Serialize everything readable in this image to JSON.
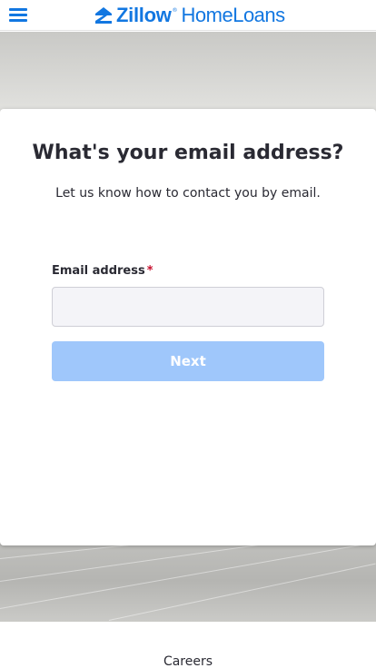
{
  "header": {
    "brand_primary": "Zillow",
    "brand_tm": "®",
    "brand_secondary": "HomeLoans",
    "menu_icon": "hamburger-menu-icon",
    "brand_color": "#1277e1"
  },
  "form": {
    "title": "What's your email address?",
    "subtitle": "Let us know how to contact you by email.",
    "email_label": "Email address",
    "required_marker": "*",
    "email_value": "",
    "email_placeholder": "",
    "next_label": "Next",
    "next_button_color": "#9fc7fb",
    "required_color": "#c8102e"
  },
  "footer": {
    "careers_label": "Careers"
  }
}
